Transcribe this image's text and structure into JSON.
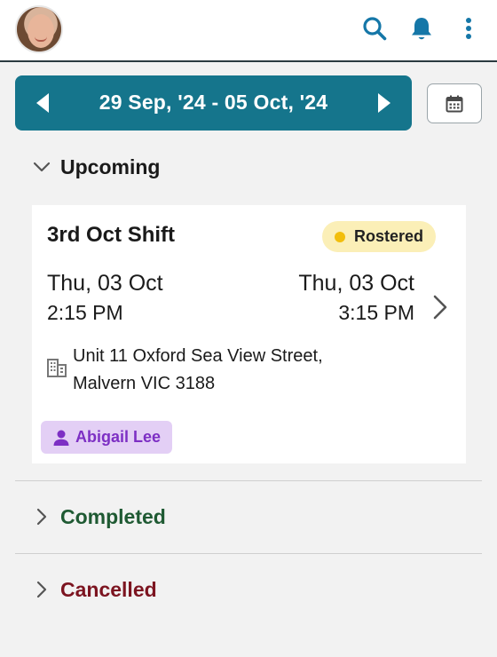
{
  "header": {
    "avatar_alt": "User profile photo",
    "icons": [
      "search-icon",
      "bell-icon",
      "more-vertical-icon"
    ],
    "icon_color": "#1577a8"
  },
  "week": {
    "range_label": "29 Sep, '24 - 05 Oct, '24",
    "bar_color": "#15758c",
    "prev_icon": "triangle-left-icon",
    "next_icon": "triangle-right-icon",
    "calendar_icon": "calendar-icon"
  },
  "sections": {
    "upcoming": {
      "label": "Upcoming",
      "expanded": true,
      "color": "#1a1a1a"
    },
    "completed": {
      "label": "Completed",
      "expanded": false,
      "color": "#1f5a33"
    },
    "cancelled": {
      "label": "Cancelled",
      "expanded": false,
      "color": "#7c1420"
    }
  },
  "shift": {
    "title": "3rd Oct Shift",
    "status": "Rostered",
    "status_colors": {
      "badge": "#fbefb7",
      "dot": "#f2be0c"
    },
    "start_date": "Thu, 03 Oct",
    "start_time": "2:15 PM",
    "end_date": "Thu, 03 Oct",
    "end_time": "3:15 PM",
    "address_line1": "Unit 11 Oxford Sea View Street,",
    "address_line2": "Malvern VIC 3188",
    "address_icon": "building-icon",
    "assignee": "Abigail Lee",
    "assignee_icon": "person-icon",
    "assignee_colors": {
      "chip": "#e3cff5",
      "text": "#7d2fc4"
    }
  }
}
